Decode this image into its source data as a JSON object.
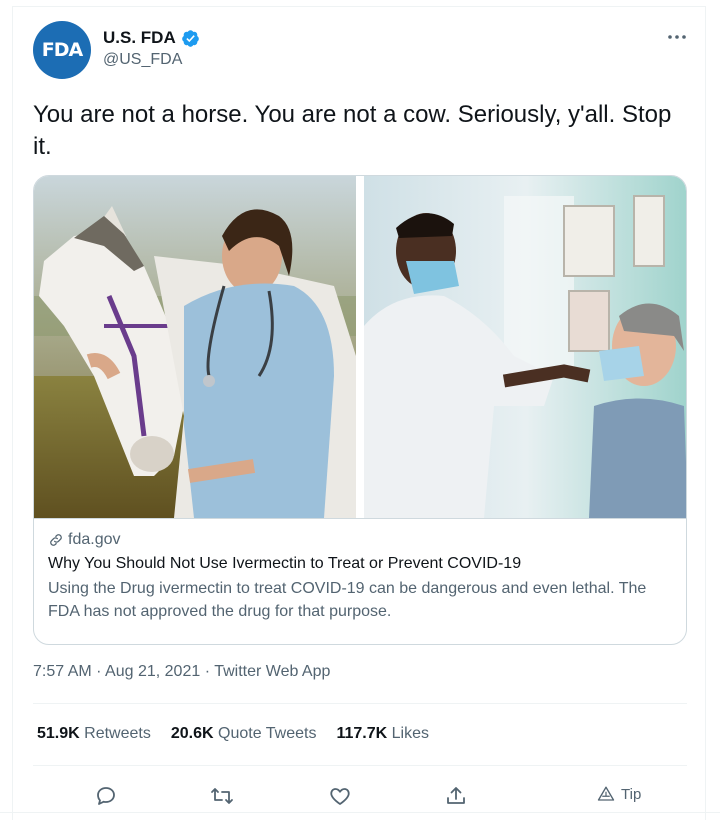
{
  "author": {
    "avatar_text": "FDA",
    "display_name": "U.S. FDA",
    "handle": "@US_FDA"
  },
  "tweet": {
    "text": "You are not a horse. You are not a cow. Seriously, y'all. Stop it."
  },
  "card": {
    "domain": "fda.gov",
    "title": "Why You Should Not Use Ivermectin to Treat or Prevent COVID-19",
    "description": "Using the Drug ivermectin to treat COVID-19 can be dangerous and even lethal. The FDA has not approved the drug for that purpose."
  },
  "meta": {
    "time": "7:57 AM",
    "date": "Aug 21, 2021",
    "source": "Twitter Web App"
  },
  "stats": {
    "retweets_count": "51.9K",
    "retweets_label": "Retweets",
    "quotes_count": "20.6K",
    "quotes_label": "Quote Tweets",
    "likes_count": "117.7K",
    "likes_label": "Likes"
  },
  "actions": {
    "tip_label": "Tip"
  },
  "colors": {
    "avatar_bg": "#1c6db4",
    "verified": "#1d9bf0",
    "secondary_text": "#536471"
  }
}
